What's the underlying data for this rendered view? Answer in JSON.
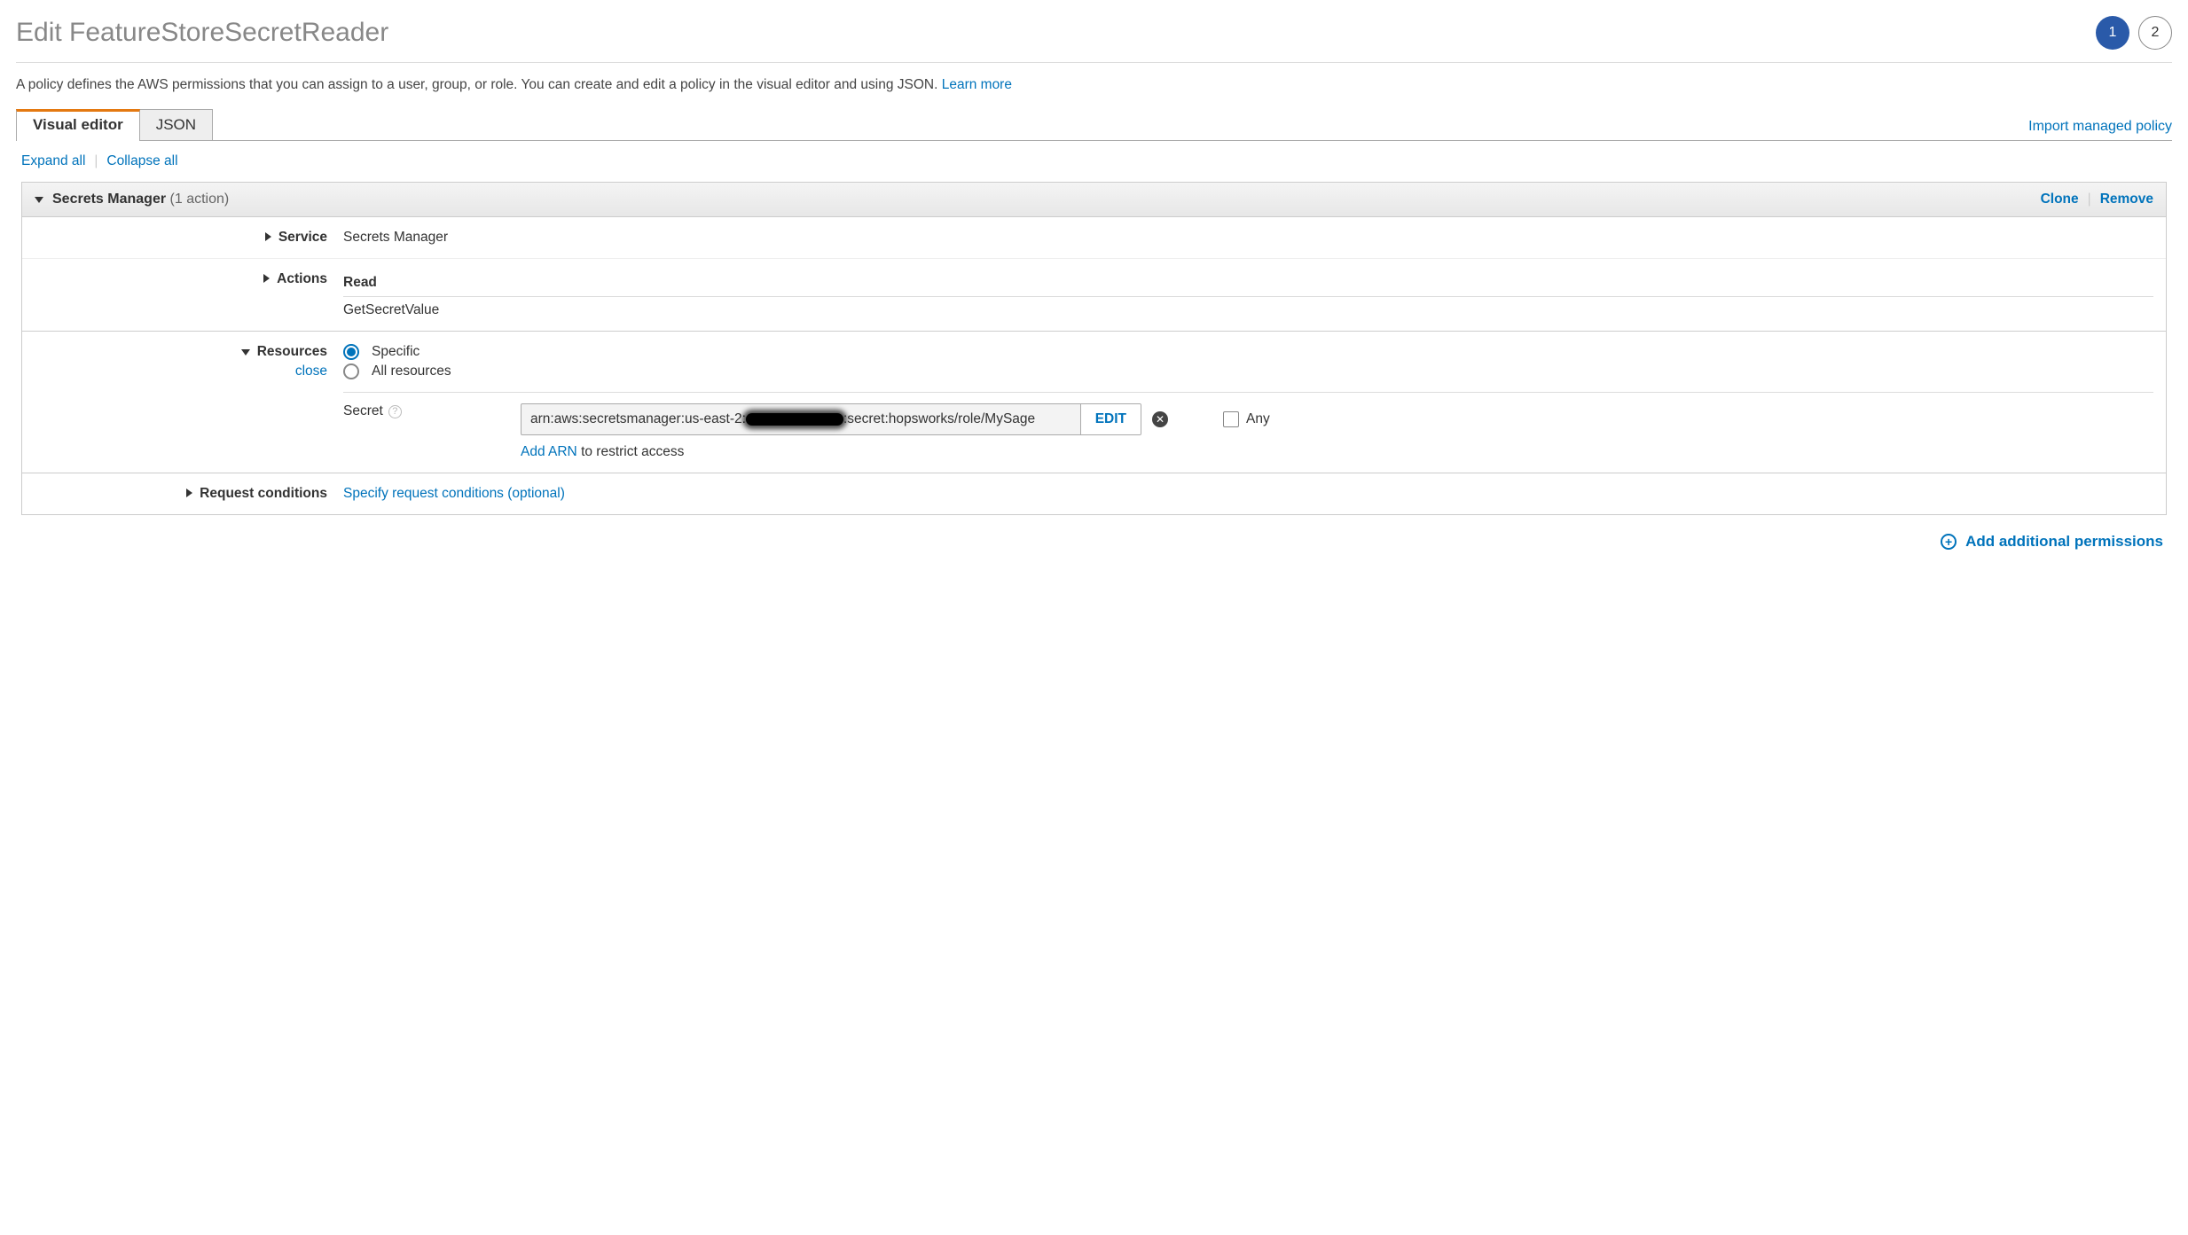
{
  "page_title": "Edit FeatureStoreSecretReader",
  "steps": {
    "current": "1",
    "next": "2"
  },
  "description": "A policy defines the AWS permissions that you can assign to a user, group, or role. You can create and edit a policy in the visual editor and using JSON.",
  "learn_more_label": "Learn more",
  "tabs": {
    "visual": "Visual editor",
    "json": "JSON"
  },
  "import_label": "Import managed policy",
  "expand_all_label": "Expand all",
  "collapse_all_label": "Collapse all",
  "panel": {
    "service_name": "Secrets Manager",
    "action_count_label": "(1 action)",
    "clone_label": "Clone",
    "remove_label": "Remove",
    "rows": {
      "service": {
        "label": "Service",
        "value": "Secrets Manager"
      },
      "actions": {
        "label": "Actions",
        "group": "Read",
        "action": "GetSecretValue"
      },
      "resources": {
        "label": "Resources",
        "close_label": "close",
        "opt_specific": "Specific",
        "opt_all": "All resources",
        "secret_label": "Secret",
        "arn_prefix": "arn:aws:secretsmanager:us-east-2:",
        "arn_suffix": ":secret:hopsworks/role/MySage",
        "edit_label": "EDIT",
        "add_arn_label": "Add ARN",
        "add_arn_suffix": " to restrict access",
        "any_label": "Any"
      },
      "conditions": {
        "label": "Request conditions",
        "specify_label": "Specify request conditions (optional)"
      }
    }
  },
  "add_permissions_label": "Add additional permissions"
}
